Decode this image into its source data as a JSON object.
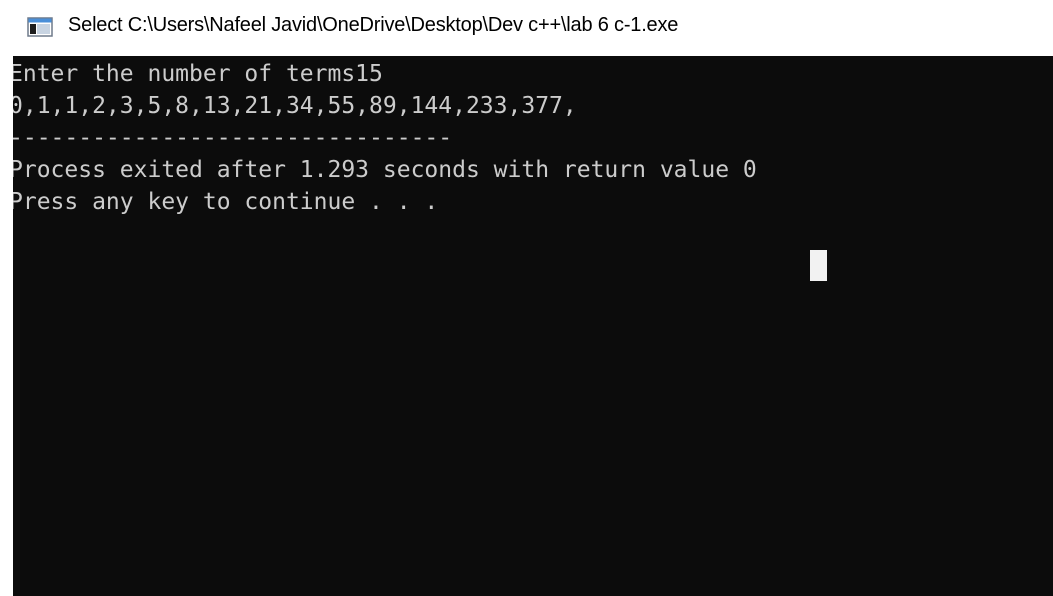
{
  "window": {
    "title": "Select C:\\Users\\Nafeel Javid\\OneDrive\\Desktop\\Dev c++\\lab 6 c-1.exe",
    "icon": "console-app-icon"
  },
  "console": {
    "lines": [
      "Enter the number of terms15",
      "0,1,1,2,3,5,8,13,21,34,55,89,144,233,377,",
      "--------------------------------",
      "Process exited after 1.293 seconds with return value 0",
      "Press any key to continue . . ."
    ],
    "colors": {
      "background": "#0c0c0c",
      "foreground": "#cccccc",
      "cursor": "#f2f2f2"
    }
  }
}
